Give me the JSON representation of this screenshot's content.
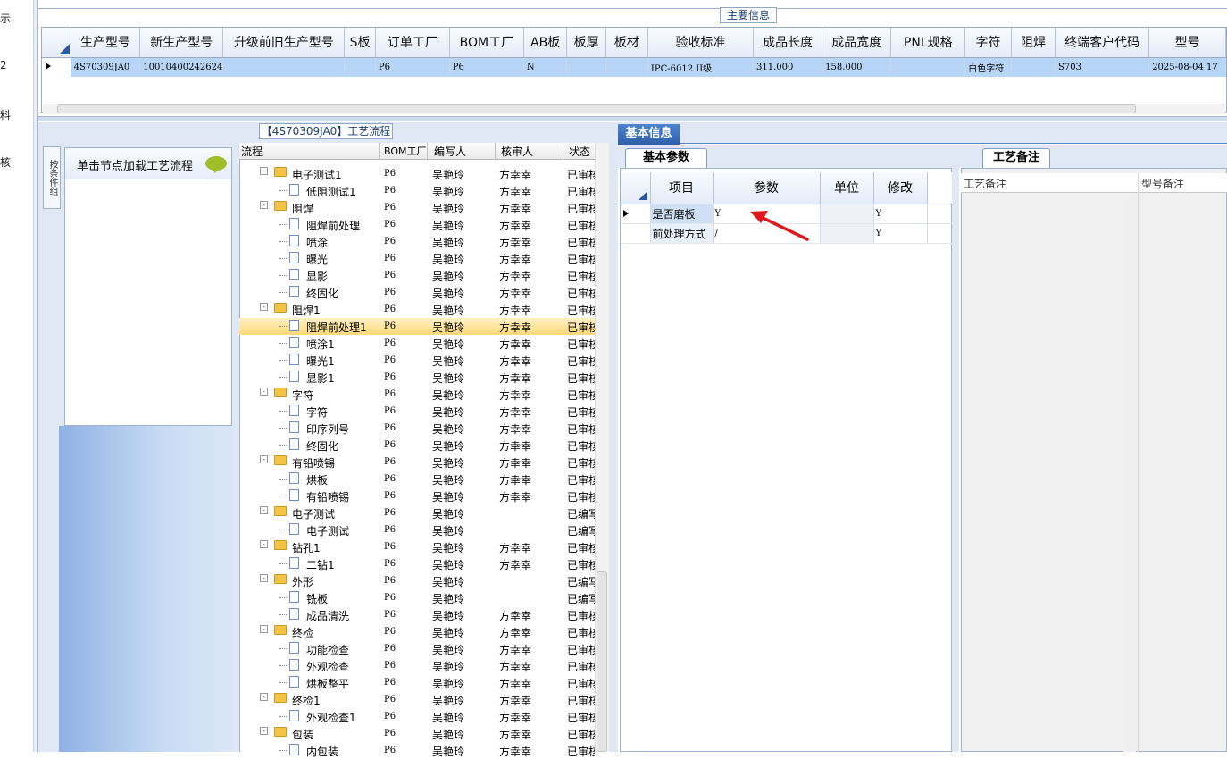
{
  "left_nav": [
    "示",
    "2",
    "料",
    "核"
  ],
  "main_info": {
    "title": "主要信息",
    "columns": [
      "生产型号",
      "新生产型号",
      "升级前旧生产型号",
      "S板",
      "订单工厂",
      "BOM工厂",
      "AB板",
      "板厚",
      "板材",
      "验收标准",
      "成品长度",
      "成品宽度",
      "PNL规格",
      "字符",
      "阻焊",
      "终端客户代码",
      "型号"
    ],
    "row": [
      "4S70309JA0",
      "10010400242624",
      "",
      "",
      "P6",
      "P6",
      "N",
      "",
      "",
      "IPC-6012 II级",
      "311.000",
      "158.000",
      "",
      "白色字符",
      "",
      "S703",
      "2025-08-04 17"
    ]
  },
  "process": {
    "title": "【4S70309JA0】工艺流程",
    "side_tab": "按条件组",
    "hint": "单击节点加载工艺流程",
    "tree_columns": [
      "流程",
      "BOM工厂",
      "编写人",
      "核审人",
      "状态"
    ],
    "rows": [
      {
        "name": "电子测试1",
        "level": 0,
        "bom": "P6",
        "writer": "吴艳玲",
        "reviewer": "方幸幸",
        "status": "已审核"
      },
      {
        "name": "低阻测试1",
        "level": 1,
        "bom": "P6",
        "writer": "吴艳玲",
        "reviewer": "方幸幸",
        "status": "已审核"
      },
      {
        "name": "阻焊",
        "level": 0,
        "bom": "P6",
        "writer": "吴艳玲",
        "reviewer": "方幸幸",
        "status": "已审核"
      },
      {
        "name": "阻焊前处理",
        "level": 1,
        "bom": "P6",
        "writer": "吴艳玲",
        "reviewer": "方幸幸",
        "status": "已审核"
      },
      {
        "name": "喷涂",
        "level": 1,
        "bom": "P6",
        "writer": "吴艳玲",
        "reviewer": "方幸幸",
        "status": "已审核"
      },
      {
        "name": "曝光",
        "level": 1,
        "bom": "P6",
        "writer": "吴艳玲",
        "reviewer": "方幸幸",
        "status": "已审核"
      },
      {
        "name": "显影",
        "level": 1,
        "bom": "P6",
        "writer": "吴艳玲",
        "reviewer": "方幸幸",
        "status": "已审核"
      },
      {
        "name": "终固化",
        "level": 1,
        "bom": "P6",
        "writer": "吴艳玲",
        "reviewer": "方幸幸",
        "status": "已审核"
      },
      {
        "name": "阻焊1",
        "level": 0,
        "bom": "P6",
        "writer": "吴艳玲",
        "reviewer": "方幸幸",
        "status": "已审核"
      },
      {
        "name": "阻焊前处理1",
        "level": 1,
        "bom": "P6",
        "writer": "吴艳玲",
        "reviewer": "方幸幸",
        "status": "已审核",
        "selected": true
      },
      {
        "name": "喷涂1",
        "level": 1,
        "bom": "P6",
        "writer": "吴艳玲",
        "reviewer": "方幸幸",
        "status": "已审核"
      },
      {
        "name": "曝光1",
        "level": 1,
        "bom": "P6",
        "writer": "吴艳玲",
        "reviewer": "方幸幸",
        "status": "已审核"
      },
      {
        "name": "显影1",
        "level": 1,
        "bom": "P6",
        "writer": "吴艳玲",
        "reviewer": "方幸幸",
        "status": "已审核"
      },
      {
        "name": "字符",
        "level": 0,
        "bom": "P6",
        "writer": "吴艳玲",
        "reviewer": "方幸幸",
        "status": "已审核"
      },
      {
        "name": "字符",
        "level": 1,
        "bom": "P6",
        "writer": "吴艳玲",
        "reviewer": "方幸幸",
        "status": "已审核"
      },
      {
        "name": "印序列号",
        "level": 1,
        "bom": "P6",
        "writer": "吴艳玲",
        "reviewer": "方幸幸",
        "status": "已审核"
      },
      {
        "name": "终固化",
        "level": 1,
        "bom": "P6",
        "writer": "吴艳玲",
        "reviewer": "方幸幸",
        "status": "已审核"
      },
      {
        "name": "有铅喷锡",
        "level": 0,
        "bom": "P6",
        "writer": "吴艳玲",
        "reviewer": "方幸幸",
        "status": "已审核"
      },
      {
        "name": "烘板",
        "level": 1,
        "bom": "P6",
        "writer": "吴艳玲",
        "reviewer": "方幸幸",
        "status": "已审核"
      },
      {
        "name": "有铅喷锡",
        "level": 1,
        "bom": "P6",
        "writer": "吴艳玲",
        "reviewer": "方幸幸",
        "status": "已审核"
      },
      {
        "name": "电子测试",
        "level": 0,
        "bom": "P6",
        "writer": "吴艳玲",
        "reviewer": "",
        "status": "已编写"
      },
      {
        "name": "电子测试",
        "level": 1,
        "bom": "P6",
        "writer": "吴艳玲",
        "reviewer": "",
        "status": "已编写"
      },
      {
        "name": "钻孔1",
        "level": 0,
        "bom": "P6",
        "writer": "吴艳玲",
        "reviewer": "方幸幸",
        "status": "已审核"
      },
      {
        "name": "二钻1",
        "level": 1,
        "bom": "P6",
        "writer": "吴艳玲",
        "reviewer": "方幸幸",
        "status": "已审核"
      },
      {
        "name": "外形",
        "level": 0,
        "bom": "P6",
        "writer": "吴艳玲",
        "reviewer": "",
        "status": "已编写"
      },
      {
        "name": "铣板",
        "level": 1,
        "bom": "P6",
        "writer": "吴艳玲",
        "reviewer": "",
        "status": "已编写"
      },
      {
        "name": "成品清洗",
        "level": 1,
        "bom": "P6",
        "writer": "吴艳玲",
        "reviewer": "方幸幸",
        "status": "已审核"
      },
      {
        "name": "终检",
        "level": 0,
        "bom": "P6",
        "writer": "吴艳玲",
        "reviewer": "方幸幸",
        "status": "已审核"
      },
      {
        "name": "功能检查",
        "level": 1,
        "bom": "P6",
        "writer": "吴艳玲",
        "reviewer": "方幸幸",
        "status": "已审核"
      },
      {
        "name": "外观检查",
        "level": 1,
        "bom": "P6",
        "writer": "吴艳玲",
        "reviewer": "方幸幸",
        "status": "已审核"
      },
      {
        "name": "烘板整平",
        "level": 1,
        "bom": "P6",
        "writer": "吴艳玲",
        "reviewer": "方幸幸",
        "status": "已审核"
      },
      {
        "name": "终检1",
        "level": 0,
        "bom": "P6",
        "writer": "吴艳玲",
        "reviewer": "方幸幸",
        "status": "已审核"
      },
      {
        "name": "外观检查1",
        "level": 1,
        "bom": "P6",
        "writer": "吴艳玲",
        "reviewer": "方幸幸",
        "status": "已审核"
      },
      {
        "name": "包装",
        "level": 0,
        "bom": "P6",
        "writer": "吴艳玲",
        "reviewer": "方幸幸",
        "status": "已审核"
      },
      {
        "name": "内包装",
        "level": 1,
        "bom": "P6",
        "writer": "吴艳玲",
        "reviewer": "方幸幸",
        "status": "已审核"
      }
    ]
  },
  "basic": {
    "tab": "基本信息",
    "params_tab": "基本参数",
    "columns": [
      "项目",
      "参数",
      "单位",
      "修改"
    ],
    "rows": [
      {
        "item": "是否磨板",
        "param": "Y",
        "unit": "",
        "modify": "Y"
      },
      {
        "item": "前处理方式",
        "param": "/",
        "unit": "",
        "modify": "Y"
      }
    ]
  },
  "notes": {
    "tab": "工艺备注",
    "col1": "工艺备注",
    "col2": "型号备注"
  }
}
